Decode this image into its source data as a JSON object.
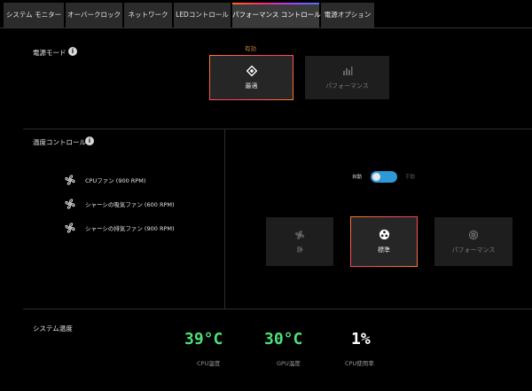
{
  "tabs": [
    {
      "label": "システム モニター",
      "active": false
    },
    {
      "label": "オーバークロック",
      "active": false
    },
    {
      "label": "ネットワーク",
      "active": false
    },
    {
      "label": "LEDコントロール",
      "active": false
    },
    {
      "label": "パフォーマンス コントロール",
      "active": true
    },
    {
      "label": "電源オプション",
      "active": false
    }
  ],
  "power_mode": {
    "title": "電源モード",
    "active_tag": "有効",
    "options": [
      {
        "label": "最適",
        "icon": "diamond-icon",
        "state": "selected"
      },
      {
        "label": "パフォーマンス",
        "icon": "bars-icon",
        "state": "disabled"
      }
    ]
  },
  "thermal": {
    "title": "温度コントロール",
    "fans": [
      {
        "label": "CPUファン (900 RPM)"
      },
      {
        "label": "シャーシの吸気ファン (600 RPM)"
      },
      {
        "label": "シャーシの排気ファン (900 RPM)"
      }
    ],
    "toggle_on_label": "自動",
    "toggle_off_label": "手動",
    "toggle_on": true,
    "options": [
      {
        "label": "静",
        "icon": "fan-icon",
        "state": "disabled"
      },
      {
        "label": "標準",
        "icon": "balanced-icon",
        "state": "selected"
      },
      {
        "label": "パフォーマンス",
        "icon": "turbo-icon",
        "state": "disabled"
      }
    ]
  },
  "system_temp": {
    "title": "システム温度",
    "readings": [
      {
        "value": "39°C",
        "caption": "CPU温度",
        "color": "#4ee07a"
      },
      {
        "value": "30°C",
        "caption": "GPU温度",
        "color": "#4ee07a"
      },
      {
        "value": "1%",
        "caption": "CPU使用率",
        "color": "#ffffff"
      }
    ]
  }
}
